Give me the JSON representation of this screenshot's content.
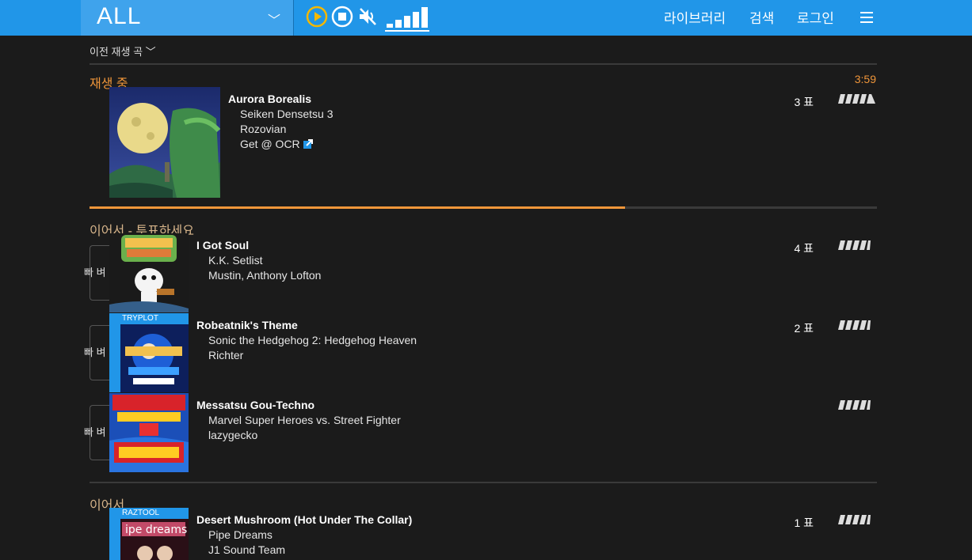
{
  "header": {
    "station": "ALL",
    "station_chevron": "﹀",
    "nav": {
      "library": "라이브러리",
      "search": "검색",
      "login": "로그인"
    },
    "icons": [
      "play-icon",
      "stop-icon",
      "mute-icon",
      "volume-bars-icon",
      "menu-icon"
    ],
    "accent": "#2196e8"
  },
  "previous": {
    "label": "이전 재생 곡 ﹀"
  },
  "now_playing": {
    "label": "재생 중",
    "time": "3:59",
    "progress": 0.68,
    "title": "Aurora Borealis",
    "album": "Seiken Densetsu 3",
    "artist": "Rozovian",
    "link": "Get @ OCR",
    "votes": "3 표",
    "accent": "#f0963a"
  },
  "next_section": {
    "label": "이어서 - 투표하세요",
    "songs": [
      {
        "title": "I Got Soul",
        "album": "K.K. Setlist",
        "artist": "Mustin, Anthony Lofton",
        "votes": "4 표",
        "side": "빠 벼"
      },
      {
        "title": "Robeatnik's Theme",
        "album": "Sonic the Hedgehog 2: Hedgehog Heaven",
        "artist": "Richter",
        "votes": "2 표",
        "side": "빠 벼",
        "tag": "TRYPLOT"
      },
      {
        "title": "Messatsu Gou-Techno",
        "album": "Marvel Super Heroes vs. Street Fighter",
        "artist": "lazygecko",
        "votes": "",
        "side": "빠 벼"
      }
    ]
  },
  "upcoming_section": {
    "label": "이어서",
    "songs": [
      {
        "title": "Desert Mushroom (Hot Under The Collar)",
        "album": "Pipe Dreams",
        "artist": "J1 Sound Team",
        "votes": "1 표",
        "tag": "RAZTOOL"
      }
    ]
  }
}
